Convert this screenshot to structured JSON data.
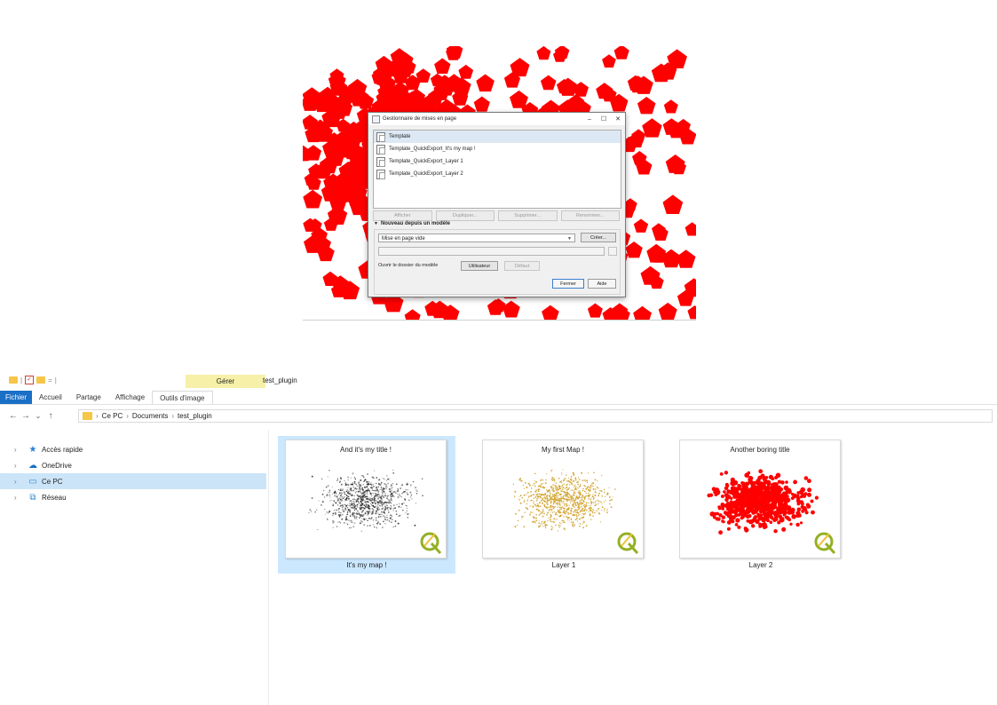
{
  "map_window": {
    "dialog": {
      "title": "Gestionnaire de mises en page",
      "controls": [
        "–",
        "☐",
        "✕"
      ],
      "layouts": [
        "Template",
        "Template_QuickExport_It's my map !",
        "Template_QuickExport_Layer 1",
        "Template_QuickExport_Layer 2"
      ],
      "selected_layout": "Template",
      "action_buttons": [
        "Afficher",
        "Dupliquer...",
        "Supprimer...",
        "Renommer..."
      ],
      "section_label": "Nouveau depuis un modèle",
      "template_select": "Mise en page vide",
      "create_button": "Créer...",
      "path_browse": "...",
      "open_folder_label": "Ouvrir le dossier du modèle",
      "user_button": "Utilisateur",
      "default_button": "Défaut",
      "close_button": "Fermer",
      "help_button": "Aide"
    },
    "marker_color": "#ff0000"
  },
  "explorer": {
    "quick_access_separator": "|",
    "quick_access_dropdown": "=",
    "manage_tab": "Gérer",
    "window_title": "test_plugin",
    "ribbon_tabs": [
      "Fichier",
      "Accueil",
      "Partage",
      "Affichage",
      "Outils d'image"
    ],
    "nav": {
      "back": "←",
      "forward": "→",
      "dropdown": "⌄",
      "up": "↑"
    },
    "breadcrumb": [
      "Ce PC",
      "Documents",
      "test_plugin"
    ],
    "breadcrumb_separator": "›",
    "tree": [
      {
        "label": "Accès rapide",
        "icon": "star-icon",
        "selected": false
      },
      {
        "label": "OneDrive",
        "icon": "cloud-icon",
        "selected": false
      },
      {
        "label": "Ce PC",
        "icon": "computer-icon",
        "selected": true
      },
      {
        "label": "Réseau",
        "icon": "network-icon",
        "selected": false
      }
    ],
    "files": [
      {
        "name": "It's my map !",
        "title": "And it's my title !",
        "color": "#1a1a1a",
        "selected": true
      },
      {
        "name": "Layer 1",
        "title": "My first Map !",
        "color": "#d4a83a",
        "selected": false
      },
      {
        "name": "Layer 2",
        "title": "Another boring title",
        "color": "#ff0000",
        "selected": false
      }
    ],
    "accent": "#1a6fc6",
    "selection_color": "#cce8ff"
  }
}
